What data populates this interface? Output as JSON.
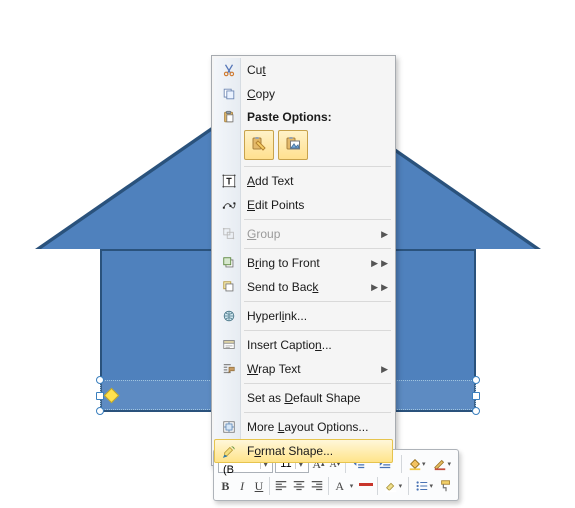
{
  "colors": {
    "shape_fill": "#4f81bd",
    "shape_outline": "#2a527c",
    "menu_hover_start": "#fff7da",
    "menu_hover_end": "#ffe48a"
  },
  "context_menu": {
    "cut": "Cut",
    "copy": "Copy",
    "paste_header": "Paste Options:",
    "add_text": "Add Text",
    "edit_points": "Edit Points",
    "group": "Group",
    "bring_front": "Bring to Front",
    "send_back": "Send to Back",
    "hyperlink": "Hyperlink...",
    "insert_caption": "Insert Caption...",
    "wrap_text": "Wrap Text",
    "set_default": "Set as Default Shape",
    "more_layout": "More Layout Options...",
    "format_shape": "Format Shape...",
    "paste_option_1": "keep-source-formatting",
    "paste_option_2": "picture"
  },
  "mini_toolbar": {
    "font_name": "Calibri (B",
    "font_size": "11",
    "bold": "B",
    "italic": "I",
    "underline": "U"
  }
}
